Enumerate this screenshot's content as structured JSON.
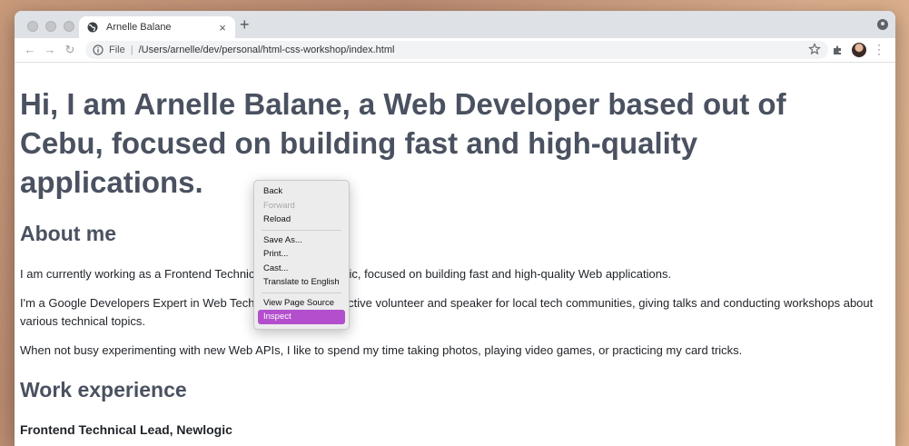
{
  "browser": {
    "tab_title": "Arnelle Balane",
    "new_tab_label": "+",
    "close_label": "×",
    "address_scheme": "File",
    "address_url": "/Users/arnelle/dev/personal/html-css-workshop/index.html"
  },
  "page": {
    "headline": "Hi, I am Arnelle Balane, a Web Developer based out of Cebu, focused on building fast and high-quality applications.",
    "about_heading": "About me",
    "about_p1": "I am currently working as a Frontend Technical Lead at Newlogic, focused on building fast and high-quality Web applications.",
    "about_p2": "I'm a Google Developers Expert in Web Technologies and an active volunteer and speaker for local tech communities, giving talks and conducting workshops about various technical topics.",
    "about_p3": "When not busy experimenting with new Web APIs, I like to spend my time taking photos, playing video games, or practicing my card tricks.",
    "work_heading": "Work experience",
    "job_title": "Frontend Technical Lead, Newlogic"
  },
  "context_menu": {
    "items": [
      {
        "label": "Back"
      },
      {
        "label": "Forward"
      },
      {
        "label": "Reload"
      },
      {
        "label": "Save As..."
      },
      {
        "label": "Print..."
      },
      {
        "label": "Cast..."
      },
      {
        "label": "Translate to English"
      },
      {
        "label": "View Page Source"
      },
      {
        "label": "Inspect"
      }
    ]
  },
  "colors": {
    "heading": "#4a5160",
    "menu_highlight": "#b34fcd"
  }
}
